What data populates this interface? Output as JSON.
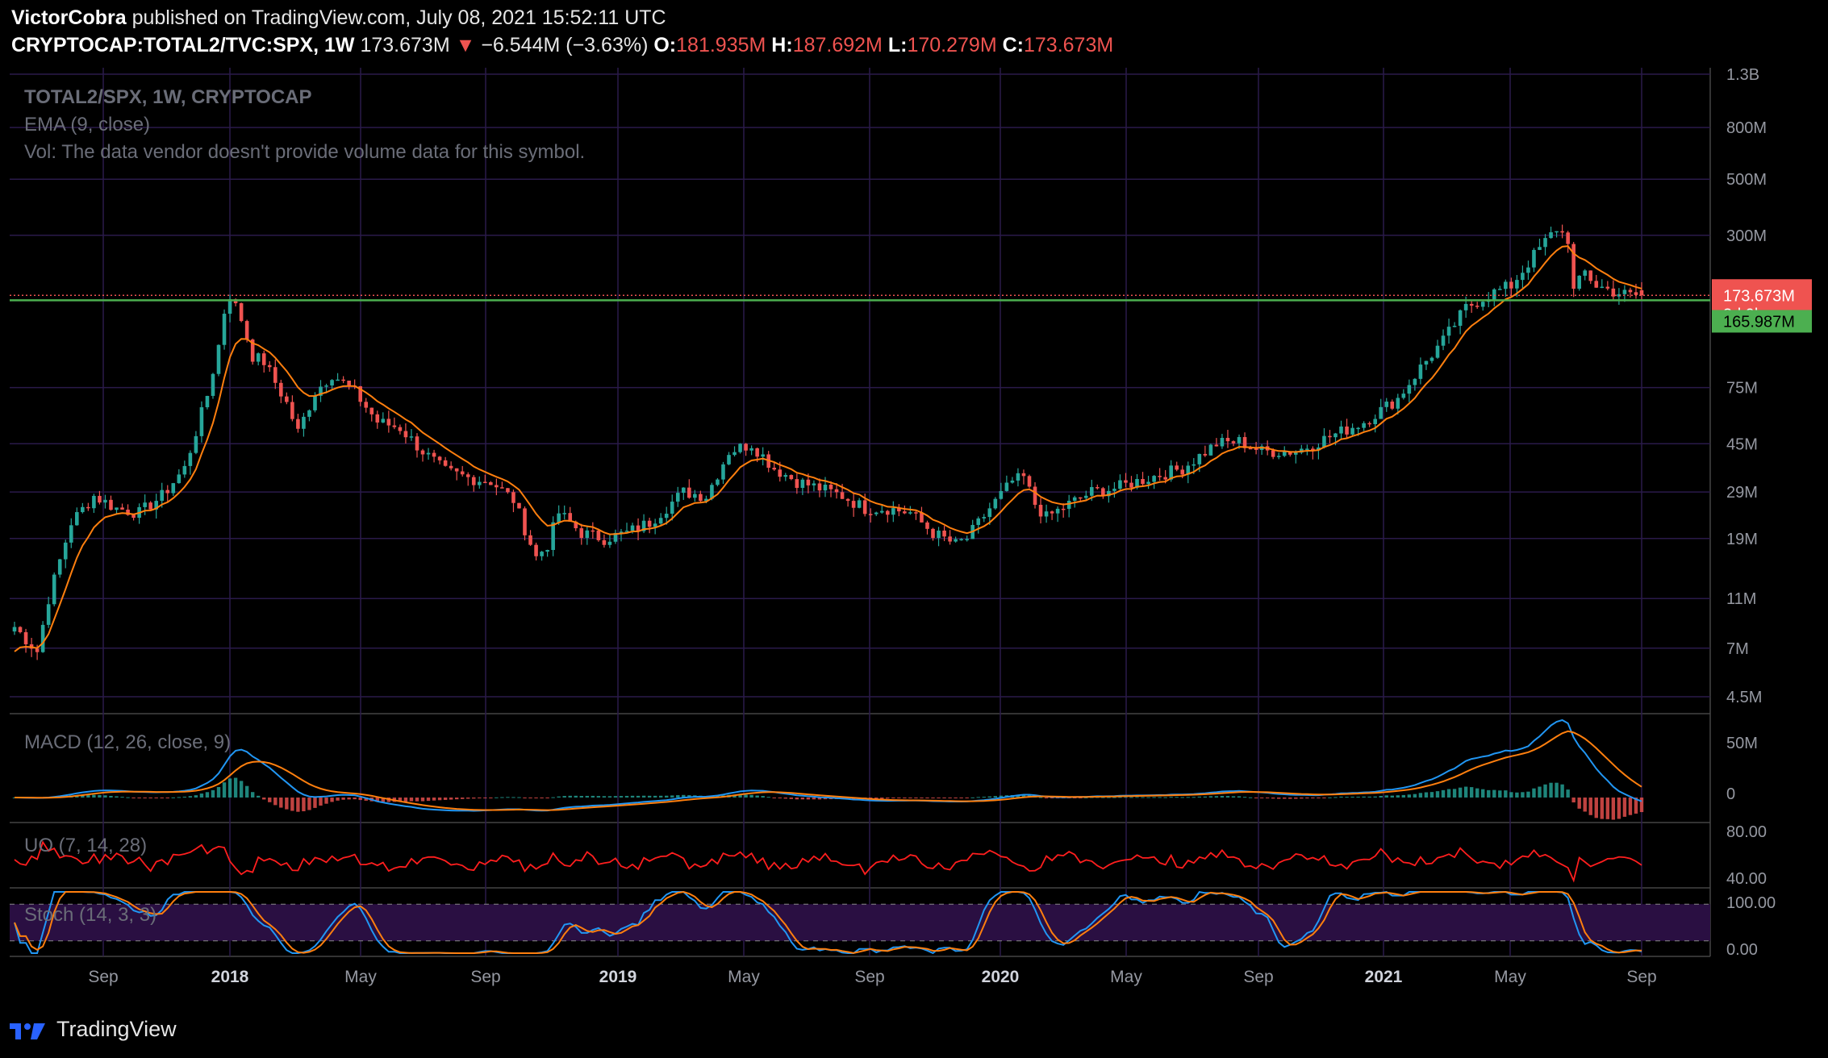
{
  "header": {
    "author": "VictorCobra",
    "published_text": "published on TradingView.com, July 08, 2021 15:52:11 UTC",
    "symbol_line": "CRYPTOCAP:TOTAL2/TVC:SPX, 1W",
    "last": "173.673M",
    "change_arrow": "▼",
    "change": "−6.544M (−3.63%)",
    "o_label": "O:",
    "o": "181.935M",
    "h_label": "H:",
    "h": "187.692M",
    "l_label": "L:",
    "l": "170.279M",
    "c_label": "C:",
    "c": "173.673M"
  },
  "legend": {
    "main": "TOTAL2/SPX, 1W, CRYPTOCAP",
    "ema": "EMA (9, close)",
    "vol": "Vol: The data vendor doesn't provide volume data for this symbol.",
    "macd": "MACD (12, 26, close, 9)",
    "uo": "UO (7, 14, 28)",
    "stoch": "Stoch (14, 3, 3)"
  },
  "footer": {
    "brand": "TradingView"
  },
  "colors": {
    "up": "#26a69a",
    "down": "#ef5350",
    "ema": "#ff7f0e",
    "grid": "#2a1a4a",
    "support": "#4caf50",
    "macd": "#2196f3",
    "signal": "#ff7f0e",
    "uo": "#ff1e1e",
    "stoch_band": "#2a0f42"
  },
  "chart_data": {
    "type": "candlestick",
    "scale": "log",
    "y_ticks": [
      "1.3B",
      "800M",
      "500M",
      "300M",
      "173.673M",
      "165.987M",
      "75M",
      "45M",
      "29M",
      "19M",
      "11M",
      "7M",
      "4.5M"
    ],
    "y_tick_values": [
      1300,
      800,
      500,
      300,
      173.673,
      165.987,
      75,
      45,
      29,
      19,
      11,
      7,
      4.5
    ],
    "x_labels": [
      "Sep",
      "2018",
      "May",
      "Sep",
      "2019",
      "May",
      "Sep",
      "2020",
      "May",
      "Sep",
      "2021",
      "May",
      "Sep"
    ],
    "last_price_label": "173.673M",
    "countdown_label": "3d 9h",
    "support_label": "165.987M",
    "support_value": 165.987,
    "key_points": [
      [
        0,
        8.5
      ],
      [
        4,
        6.8
      ],
      [
        6,
        11
      ],
      [
        10,
        22
      ],
      [
        14,
        28
      ],
      [
        18,
        25
      ],
      [
        22,
        24
      ],
      [
        26,
        28
      ],
      [
        30,
        36
      ],
      [
        34,
        70
      ],
      [
        36,
        110
      ],
      [
        37,
        150
      ],
      [
        38,
        175
      ],
      [
        40,
        140
      ],
      [
        42,
        100
      ],
      [
        44,
        95
      ],
      [
        48,
        65
      ],
      [
        50,
        50
      ],
      [
        53,
        72
      ],
      [
        56,
        85
      ],
      [
        60,
        72
      ],
      [
        64,
        55
      ],
      [
        68,
        52
      ],
      [
        72,
        42
      ],
      [
        76,
        35
      ],
      [
        80,
        33
      ],
      [
        84,
        32
      ],
      [
        88,
        27
      ],
      [
        92,
        16
      ],
      [
        94,
        18
      ],
      [
        96,
        24
      ],
      [
        100,
        20
      ],
      [
        104,
        19
      ],
      [
        108,
        20
      ],
      [
        112,
        22
      ],
      [
        118,
        29
      ],
      [
        122,
        28
      ],
      [
        126,
        42
      ],
      [
        130,
        45
      ],
      [
        134,
        36
      ],
      [
        138,
        32
      ],
      [
        142,
        30
      ],
      [
        146,
        28
      ],
      [
        150,
        25
      ],
      [
        154,
        25
      ],
      [
        158,
        24
      ],
      [
        162,
        20
      ],
      [
        166,
        18
      ],
      [
        168,
        19
      ],
      [
        172,
        25
      ],
      [
        176,
        32
      ],
      [
        178,
        33
      ],
      [
        180,
        26
      ],
      [
        182,
        23
      ],
      [
        186,
        26
      ],
      [
        190,
        29
      ],
      [
        194,
        30
      ],
      [
        200,
        33
      ],
      [
        206,
        36
      ],
      [
        212,
        45
      ],
      [
        216,
        46
      ],
      [
        220,
        42
      ],
      [
        226,
        42
      ],
      [
        232,
        48
      ],
      [
        238,
        55
      ],
      [
        244,
        68
      ],
      [
        248,
        90
      ],
      [
        252,
        115
      ],
      [
        256,
        155
      ],
      [
        260,
        175
      ],
      [
        264,
        190
      ],
      [
        268,
        250
      ],
      [
        272,
        320
      ],
      [
        274,
        290
      ],
      [
        275,
        180
      ],
      [
        277,
        215
      ],
      [
        279,
        190
      ],
      [
        282,
        180
      ],
      [
        285,
        173.673
      ]
    ],
    "macd_ticks": [
      "50M",
      "0"
    ],
    "uo_ticks": [
      "80.00",
      "40.00"
    ],
    "stoch_ticks": [
      "100.00",
      "0.00"
    ]
  }
}
